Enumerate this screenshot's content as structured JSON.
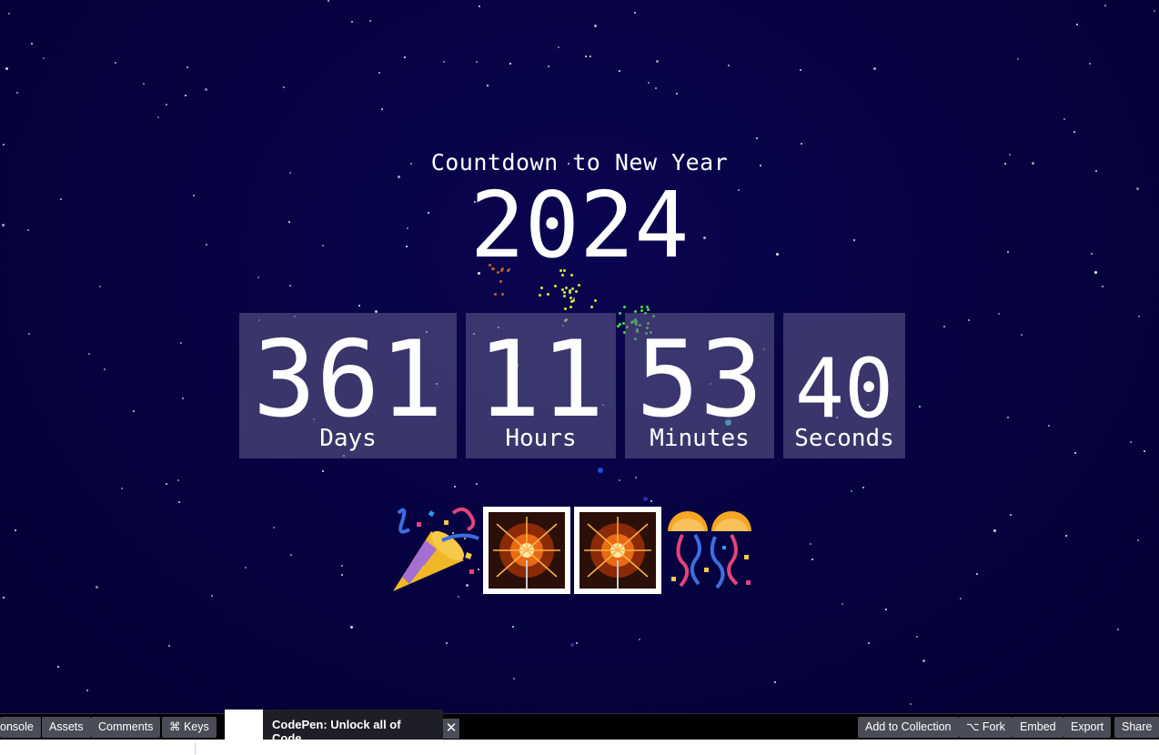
{
  "header": {
    "title": "Countdown to New Year",
    "year": "2024"
  },
  "countdown": [
    {
      "value": "361",
      "label": "Days"
    },
    {
      "value": "11",
      "label": "Hours"
    },
    {
      "value": "53",
      "label": "Minutes"
    },
    {
      "value": "40",
      "label": "Seconds"
    }
  ],
  "emojis": [
    "party-popper-icon",
    "sparkler-icon",
    "sparkler-icon",
    "confetti-ball-icon"
  ],
  "toolbar": {
    "console": "onsole",
    "assets": "Assets",
    "comments": "Comments",
    "keys": "⌘ Keys",
    "notice": "CodePen: Unlock all of Code…",
    "close": "✕",
    "add_to_collection": "Add to Collection",
    "fork": "⌥ Fork",
    "embed": "Embed",
    "export": "Export",
    "share": "Share"
  },
  "colors": {
    "background": "#05013a",
    "box": "#4a4670",
    "toolbar": "#000000",
    "button": "#4a4d57"
  }
}
